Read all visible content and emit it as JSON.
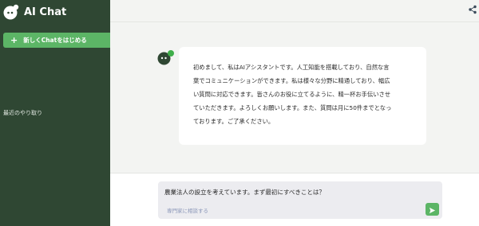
{
  "sidebar": {
    "app_title": "AI Chat",
    "logo_icon": "mascot-logo-icon",
    "new_chat_label": "新しくChatをはじめる",
    "new_chat_icon": "plus-icon",
    "recent_label": "最近のやり取り"
  },
  "header": {
    "share_icon": "share-icon"
  },
  "conversation": {
    "messages": [
      {
        "role": "assistant",
        "avatar_icon": "mascot-avatar-icon",
        "lines": [
          "初めまして、私はAIアシスタントです。人工知能を搭載しており、自然な言",
          "葉でコミュニケーションができます。私は様々な分野に精通しており、幅広",
          "い質問に対応できます。皆さんのお役に立てるように、精一杯お手伝いさせ",
          "ていただきます。よろしくお願いします。また、質問は月に50件までとなっ",
          "ております。ご了承ください。"
        ]
      }
    ]
  },
  "composer": {
    "value": "農業法人の設立を考えています。まず最初にすべきことは？",
    "placeholder": "専門家に相談する",
    "send_icon": "send-icon"
  },
  "colors": {
    "sidebar_bg": "#2f4733",
    "accent_green": "#5cb566",
    "main_bg": "#f3f4f2",
    "bubble_bg": "#ffffff",
    "composer_bg": "#ececf0"
  }
}
